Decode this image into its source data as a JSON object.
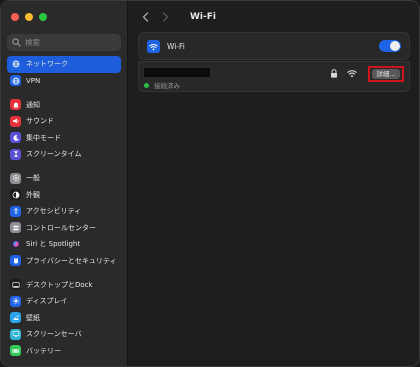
{
  "colors": {
    "accent": "#1e5ddc",
    "close": "#ff5f57",
    "minimize": "#febc2e",
    "zoom": "#28c840",
    "connected": "#2bbd41",
    "highlight": "#d0141c"
  },
  "search": {
    "placeholder": "検索"
  },
  "sidebar": {
    "groups": [
      [
        {
          "label": "ネットワーク",
          "icon": "globe-icon",
          "color": "#1e63e8",
          "selected": true
        },
        {
          "label": "VPN",
          "icon": "vpn-globe-icon",
          "color": "#1e63e8"
        }
      ],
      [
        {
          "label": "通知",
          "icon": "bell-icon",
          "color": "#e5323a"
        },
        {
          "label": "サウンド",
          "icon": "speaker-icon",
          "color": "#e5323a"
        },
        {
          "label": "集中モード",
          "icon": "moon-icon",
          "color": "#5a4fd6"
        },
        {
          "label": "スクリーンタイム",
          "icon": "hourglass-icon",
          "color": "#5a4fd6"
        }
      ],
      [
        {
          "label": "一般",
          "icon": "gear-icon",
          "color": "#8e8e93"
        },
        {
          "label": "外観",
          "icon": "appearance-icon",
          "color": "#1c1c1c"
        },
        {
          "label": "アクセシビリティ",
          "icon": "accessibility-icon",
          "color": "#1e63e8"
        },
        {
          "label": "コントロールセンター",
          "icon": "control-center-icon",
          "color": "#8e8e93"
        },
        {
          "label": "Siri と Spotlight",
          "icon": "siri-icon",
          "color": "#2a2a3a"
        },
        {
          "label": "プライバシーとセキュリティ",
          "icon": "hand-icon",
          "color": "#1e63e8"
        }
      ],
      [
        {
          "label": "デスクトップとDock",
          "icon": "dock-icon",
          "color": "#1c1c1c"
        },
        {
          "label": "ディスプレイ",
          "icon": "sun-icon",
          "color": "#1e63e8"
        },
        {
          "label": "壁紙",
          "icon": "wallpaper-icon",
          "color": "#2aa3e8"
        },
        {
          "label": "スクリーンセーバ",
          "icon": "screensaver-icon",
          "color": "#32b4d8"
        },
        {
          "label": "バッテリー",
          "icon": "battery-icon",
          "color": "#34c759"
        }
      ]
    ]
  },
  "header": {
    "title": "Wi-Fi"
  },
  "wifi": {
    "label": "Wi-Fi",
    "enabled": true,
    "icon": "wifi-icon"
  },
  "network": {
    "status": "接続済み",
    "details_label": "詳細..."
  }
}
